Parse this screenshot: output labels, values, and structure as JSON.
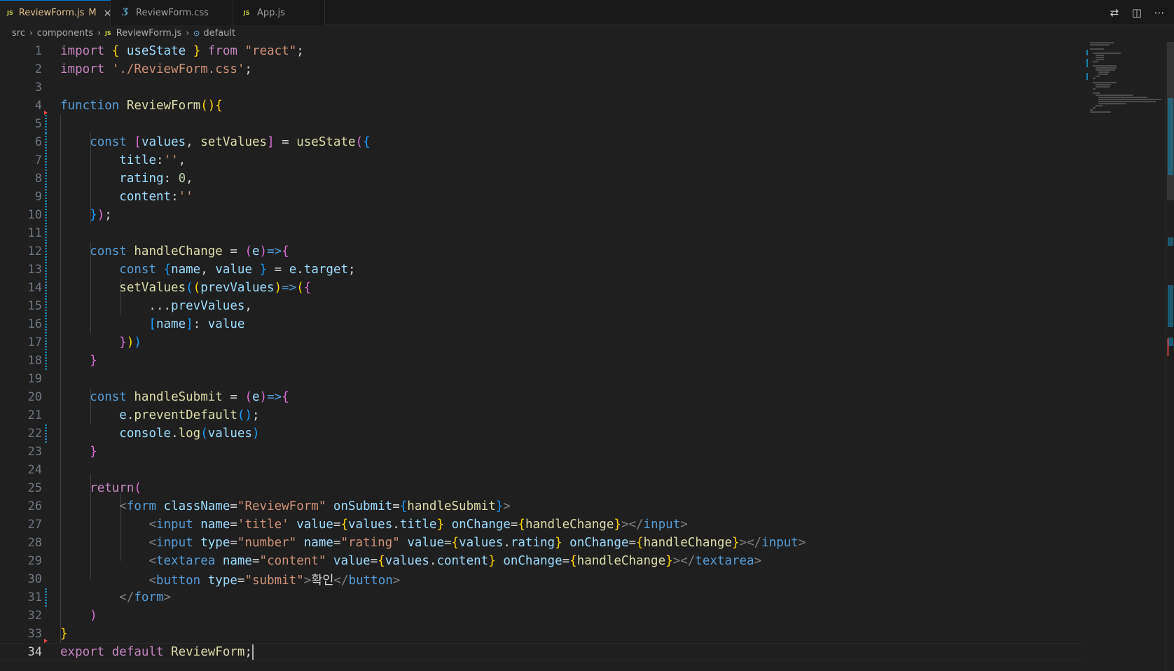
{
  "tabs": [
    {
      "label": "ReviewForm.js",
      "icon": "js-icon",
      "modified": "M",
      "close": "×",
      "active": true
    },
    {
      "label": "ReviewForm.css",
      "icon": "css-icon",
      "active": false
    },
    {
      "label": "App.js",
      "icon": "js-icon",
      "active": false
    }
  ],
  "tab_icons": {
    "js": "JS",
    "css": "Ʒ"
  },
  "actions": {
    "compare": "⇄",
    "split": "◫",
    "more": "⋯"
  },
  "breadcrumb": {
    "items": [
      "src",
      "components",
      "ReviewForm.js",
      "default"
    ],
    "separator": "›"
  },
  "editor": {
    "line_numbers": [
      "1",
      "2",
      "3",
      "4",
      "5",
      "6",
      "7",
      "8",
      "9",
      "10",
      "11",
      "12",
      "13",
      "14",
      "15",
      "16",
      "17",
      "18",
      "19",
      "20",
      "21",
      "22",
      "23",
      "24",
      "25",
      "26",
      "27",
      "28",
      "29",
      "30",
      "31",
      "32",
      "33",
      "34"
    ],
    "current_line": "34",
    "korean_button_text": "확인"
  },
  "colors": {
    "background": "#1f1f1f",
    "active_tab_accent": "#0078d4",
    "modified_text": "#e2c08d",
    "keyword": "#569cd6",
    "control_keyword": "#c586c0",
    "string": "#ce9178",
    "function": "#dcdcaa",
    "variable": "#9cdcfe"
  }
}
